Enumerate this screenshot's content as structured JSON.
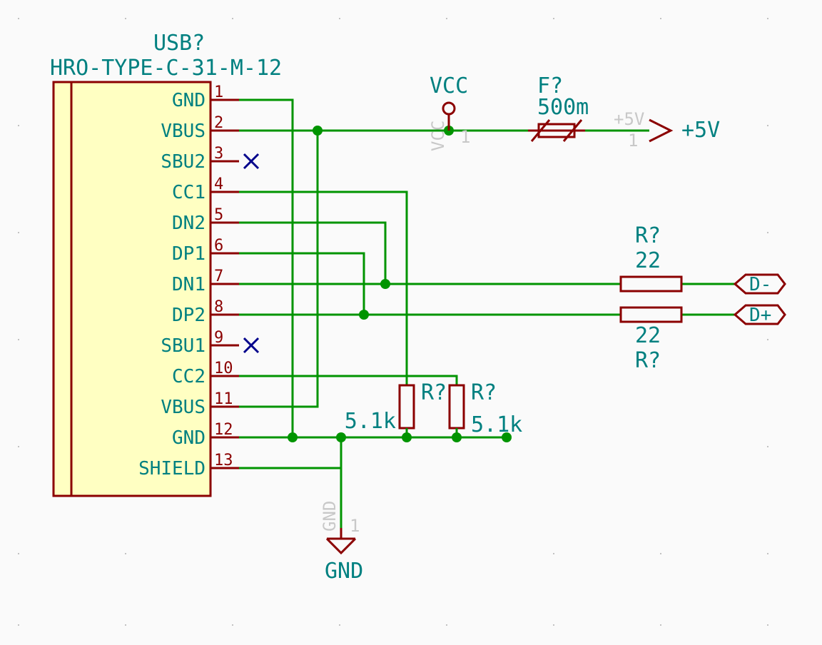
{
  "component": {
    "ref": "USB?",
    "value": "HRO-TYPE-C-31-M-12",
    "pins": [
      {
        "num": "1",
        "name": "GND"
      },
      {
        "num": "2",
        "name": "VBUS"
      },
      {
        "num": "3",
        "name": "SBU2"
      },
      {
        "num": "4",
        "name": "CC1"
      },
      {
        "num": "5",
        "name": "DN2"
      },
      {
        "num": "6",
        "name": "DP1"
      },
      {
        "num": "7",
        "name": "DN1"
      },
      {
        "num": "8",
        "name": "DP2"
      },
      {
        "num": "9",
        "name": "SBU1"
      },
      {
        "num": "10",
        "name": "CC2"
      },
      {
        "num": "11",
        "name": "VBUS"
      },
      {
        "num": "12",
        "name": "GND"
      },
      {
        "num": "13",
        "name": "SHIELD"
      }
    ]
  },
  "power": {
    "vcc": "VCC",
    "vcc_ghost_name": "VCC",
    "vcc_ghost_num": "1",
    "plus5v": "+5V",
    "plus5v_ghost_name": "+5V",
    "plus5v_ghost_num": "1",
    "gnd": "GND",
    "gnd_ghost_name": "GND",
    "gnd_ghost_num": "1"
  },
  "fuse": {
    "ref": "F?",
    "value": "500m"
  },
  "r_cc1": {
    "ref": "R?",
    "value": "5.1k"
  },
  "r_cc2": {
    "ref": "R?",
    "value": "5.1k"
  },
  "r_dm": {
    "ref": "R?",
    "value": "22"
  },
  "r_dp": {
    "ref": "R?",
    "value": "22"
  },
  "net_dm": "D-",
  "net_dp": "D+"
}
